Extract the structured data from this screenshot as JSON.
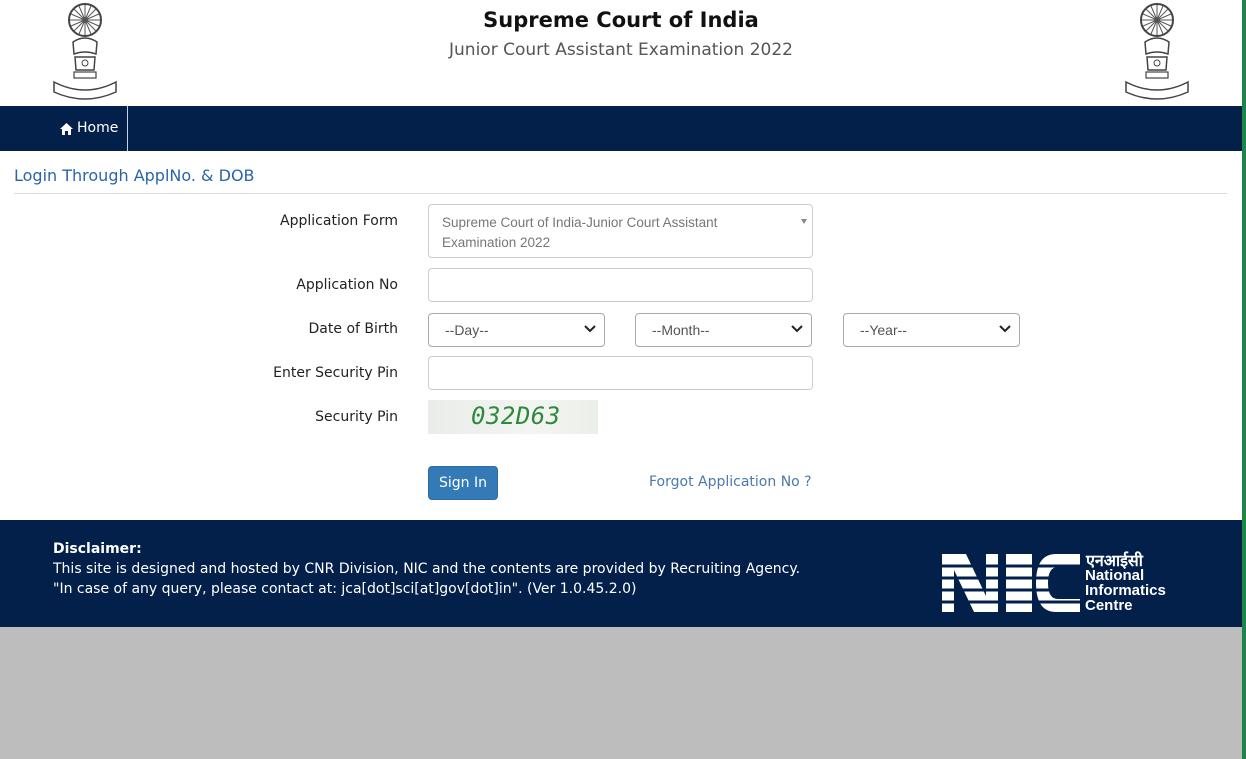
{
  "header": {
    "title": "Supreme Court of India",
    "subtitle": "Junior Court Assistant Examination 2022"
  },
  "nav": {
    "home_label": "Home",
    "home_icon": "home-icon"
  },
  "form": {
    "section_title": "Login Through ApplNo. & DOB",
    "application_form_label": "Application Form",
    "application_form_value": "Supreme Court of India-Junior Court Assistant Examination 2022",
    "application_no_label": "Application No",
    "application_no_value": "",
    "dob_label": "Date of Birth",
    "day_value": "--Day--",
    "month_value": "--Month--",
    "year_value": "--Year--",
    "enter_pin_label": "Enter Security Pin",
    "enter_pin_value": "",
    "security_pin_label": "Security Pin",
    "captcha_text": "032D63",
    "signin_label": "Sign In",
    "forgot_label": "Forgot Application No ?"
  },
  "footer": {
    "disclaimer_title": "Disclaimer:",
    "line1": "This site is designed and hosted by CNR Division, NIC and the contents are provided by Recruiting Agency.",
    "line2": "\"In case of any query, please contact at: jca[dot]sci[at]gov[dot]in\". (Ver 1.0.45.2.0)",
    "nic_hindi": "एनआईसी",
    "nic_name_1": "National",
    "nic_name_2": "Informatics",
    "nic_name_3": "Centre"
  },
  "colors": {
    "navy": "#03204b",
    "link_blue": "#2a65a8",
    "button_blue": "#337ab7",
    "captcha_green": "#2d8a3c"
  }
}
